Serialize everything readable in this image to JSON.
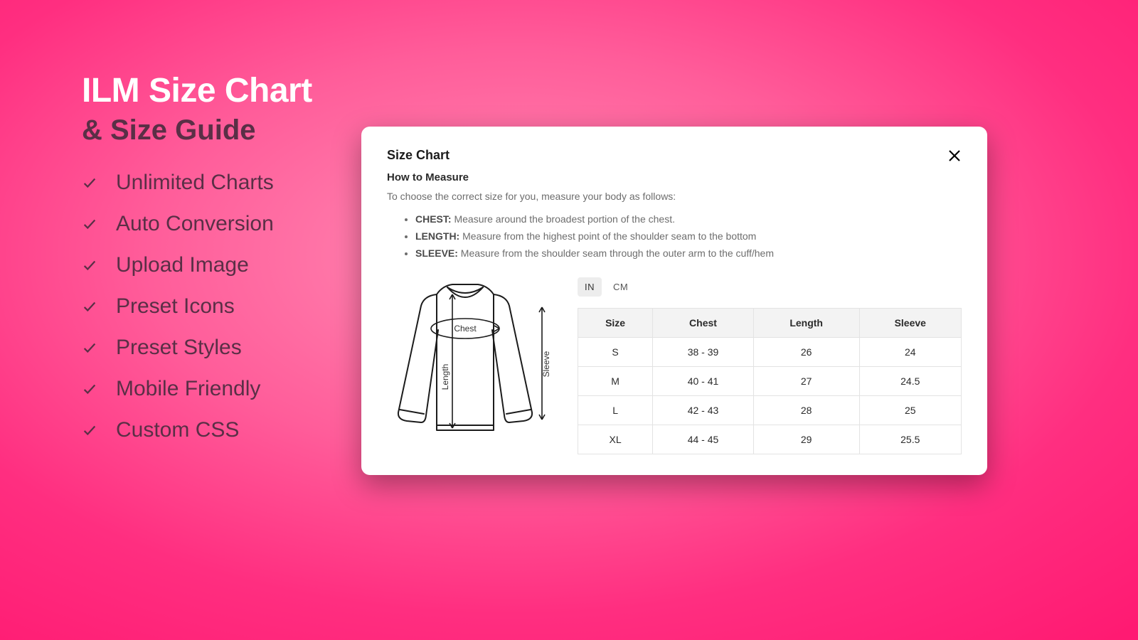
{
  "promo": {
    "title_line1": "ILM Size Chart",
    "title_line2": "& Size Guide",
    "features": [
      "Unlimited Charts",
      "Auto Conversion",
      "Upload Image",
      "Preset Icons",
      "Preset Styles",
      "Mobile Friendly",
      "Custom CSS"
    ]
  },
  "modal": {
    "title": "Size Chart",
    "subheading": "How to Measure",
    "intro": "To choose the correct size for you, measure your body as follows:",
    "measurements": [
      {
        "label": "CHEST:",
        "desc": "Measure around the broadest portion of the chest."
      },
      {
        "label": "LENGTH:",
        "desc": "Measure from the highest point of the shoulder seam to the bottom"
      },
      {
        "label": "SLEEVE:",
        "desc": "Measure from the shoulder seam through the outer arm to the cuff/hem"
      }
    ],
    "diagram_labels": {
      "chest": "Chest",
      "length": "Length",
      "sleeve": "Sleeve"
    },
    "units": {
      "in": "IN",
      "cm": "CM",
      "active": "in"
    }
  },
  "chart_data": {
    "type": "table",
    "title": "Size Chart (IN)",
    "columns": [
      "Size",
      "Chest",
      "Length",
      "Sleeve"
    ],
    "rows": [
      [
        "S",
        "38 - 39",
        "26",
        "24"
      ],
      [
        "M",
        "40 - 41",
        "27",
        "24.5"
      ],
      [
        "L",
        "42 - 43",
        "28",
        "25"
      ],
      [
        "XL",
        "44 - 45",
        "29",
        "25.5"
      ]
    ]
  }
}
